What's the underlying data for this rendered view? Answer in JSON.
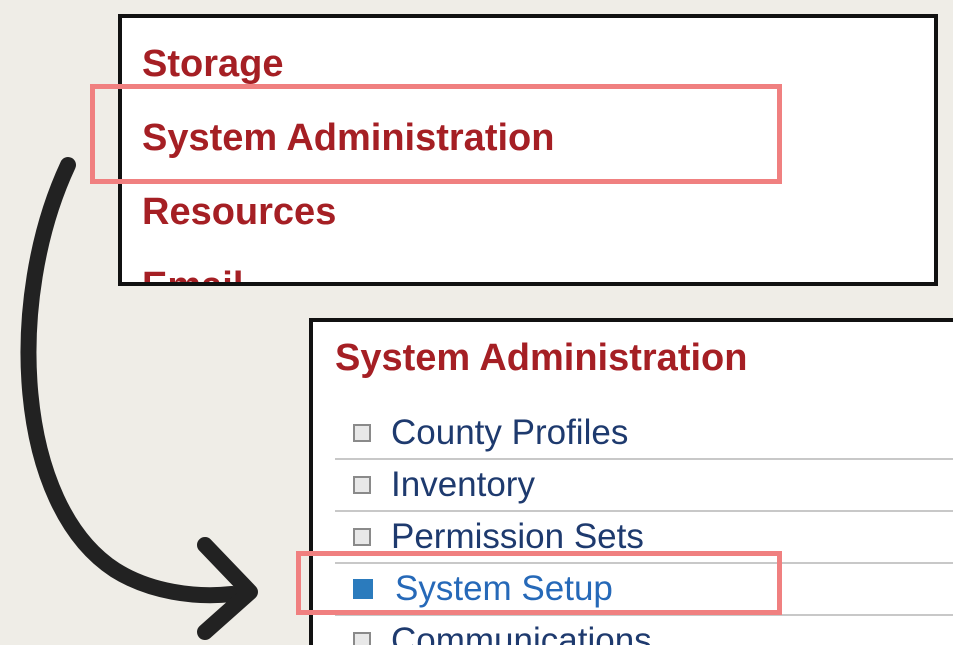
{
  "main_menu": {
    "items": [
      {
        "label": "Storage"
      },
      {
        "label": "System Administration",
        "highlighted": true
      },
      {
        "label": "Resources"
      },
      {
        "label": "Email"
      }
    ]
  },
  "sub_menu": {
    "title": "System Administration",
    "items": [
      {
        "label": "County Profiles",
        "active": false
      },
      {
        "label": "Inventory",
        "active": false
      },
      {
        "label": "Permission Sets",
        "active": false
      },
      {
        "label": "System Setup",
        "active": true
      },
      {
        "label": "Communications",
        "active": false
      }
    ]
  },
  "colors": {
    "menu_text": "#a51f24",
    "link_text": "#1e3a6e",
    "active_link": "#2669b8",
    "active_bullet": "#2b7bbd",
    "highlight": "#f08080",
    "arrow": "#222222",
    "background": "#efede7"
  },
  "icons": {
    "bullet": "square-bullet-icon",
    "arrow": "curved-arrow-icon"
  }
}
